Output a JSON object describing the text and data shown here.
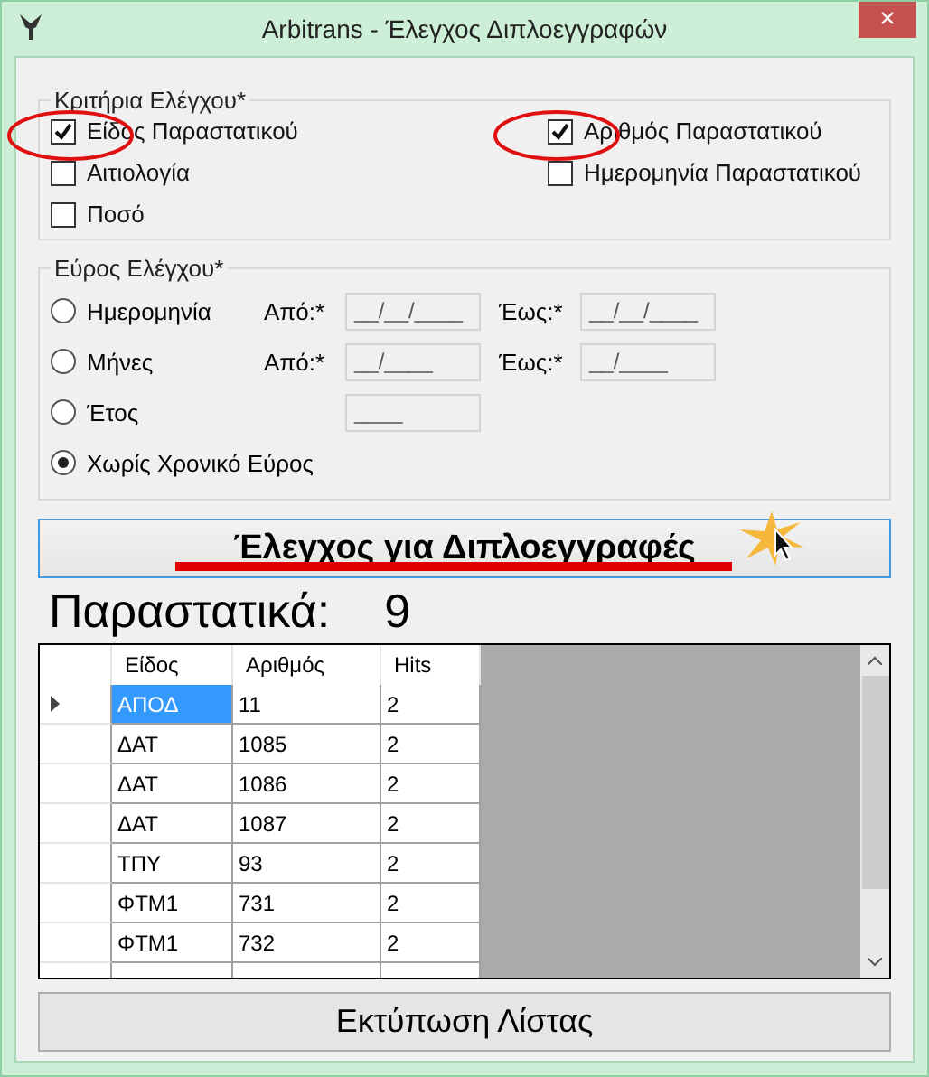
{
  "window": {
    "title": "Arbitrans - Έλεγχος Διπλοεγγραφών",
    "close": "×"
  },
  "criteria": {
    "title": "Κριτήρια Ελέγχου*",
    "items": [
      {
        "label": "Είδος Παραστατικού",
        "checked": true
      },
      {
        "label": "Αριθμός Παραστατικού",
        "checked": true
      },
      {
        "label": "Αιτιολογία",
        "checked": false
      },
      {
        "label": "Ημερομηνία Παραστατικού",
        "checked": false
      },
      {
        "label": "Ποσό",
        "checked": false
      }
    ]
  },
  "range": {
    "title": "Εύρος Ελέγχου*",
    "options": [
      {
        "label": "Ημερομηνία",
        "selected": false,
        "from_label": "Από:*",
        "from_value": "__/__/____",
        "to_label": "Έως:*",
        "to_value": "__/__/____"
      },
      {
        "label": "Μήνες",
        "selected": false,
        "from_label": "Από:*",
        "from_value": "__/____",
        "to_label": "Έως:*",
        "to_value": "__/____"
      },
      {
        "label": "Έτος",
        "selected": false,
        "from_value": "____"
      },
      {
        "label": "Χωρίς Χρονικό Εύρος",
        "selected": true
      }
    ]
  },
  "check_button": "Έλεγχος για Διπλοεγγραφές",
  "count": {
    "label": "Παραστατικά:",
    "value": "9"
  },
  "table": {
    "columns": [
      "Είδος",
      "Αριθμός",
      "Hits"
    ],
    "rows": [
      {
        "cells": [
          "ΑΠΟΔ",
          "11",
          "2"
        ],
        "selected": true
      },
      {
        "cells": [
          "ΔΑΤ",
          "1085",
          "2"
        ],
        "selected": false
      },
      {
        "cells": [
          "ΔΑΤ",
          "1086",
          "2"
        ],
        "selected": false
      },
      {
        "cells": [
          "ΔΑΤ",
          "1087",
          "2"
        ],
        "selected": false
      },
      {
        "cells": [
          "ΤΠΥ",
          "93",
          "2"
        ],
        "selected": false
      },
      {
        "cells": [
          "ΦΤΜ1",
          "731",
          "2"
        ],
        "selected": false
      },
      {
        "cells": [
          "ΦΤΜ1",
          "732",
          "2"
        ],
        "selected": false
      }
    ]
  },
  "print_button": "Εκτύπωση Λίστας"
}
